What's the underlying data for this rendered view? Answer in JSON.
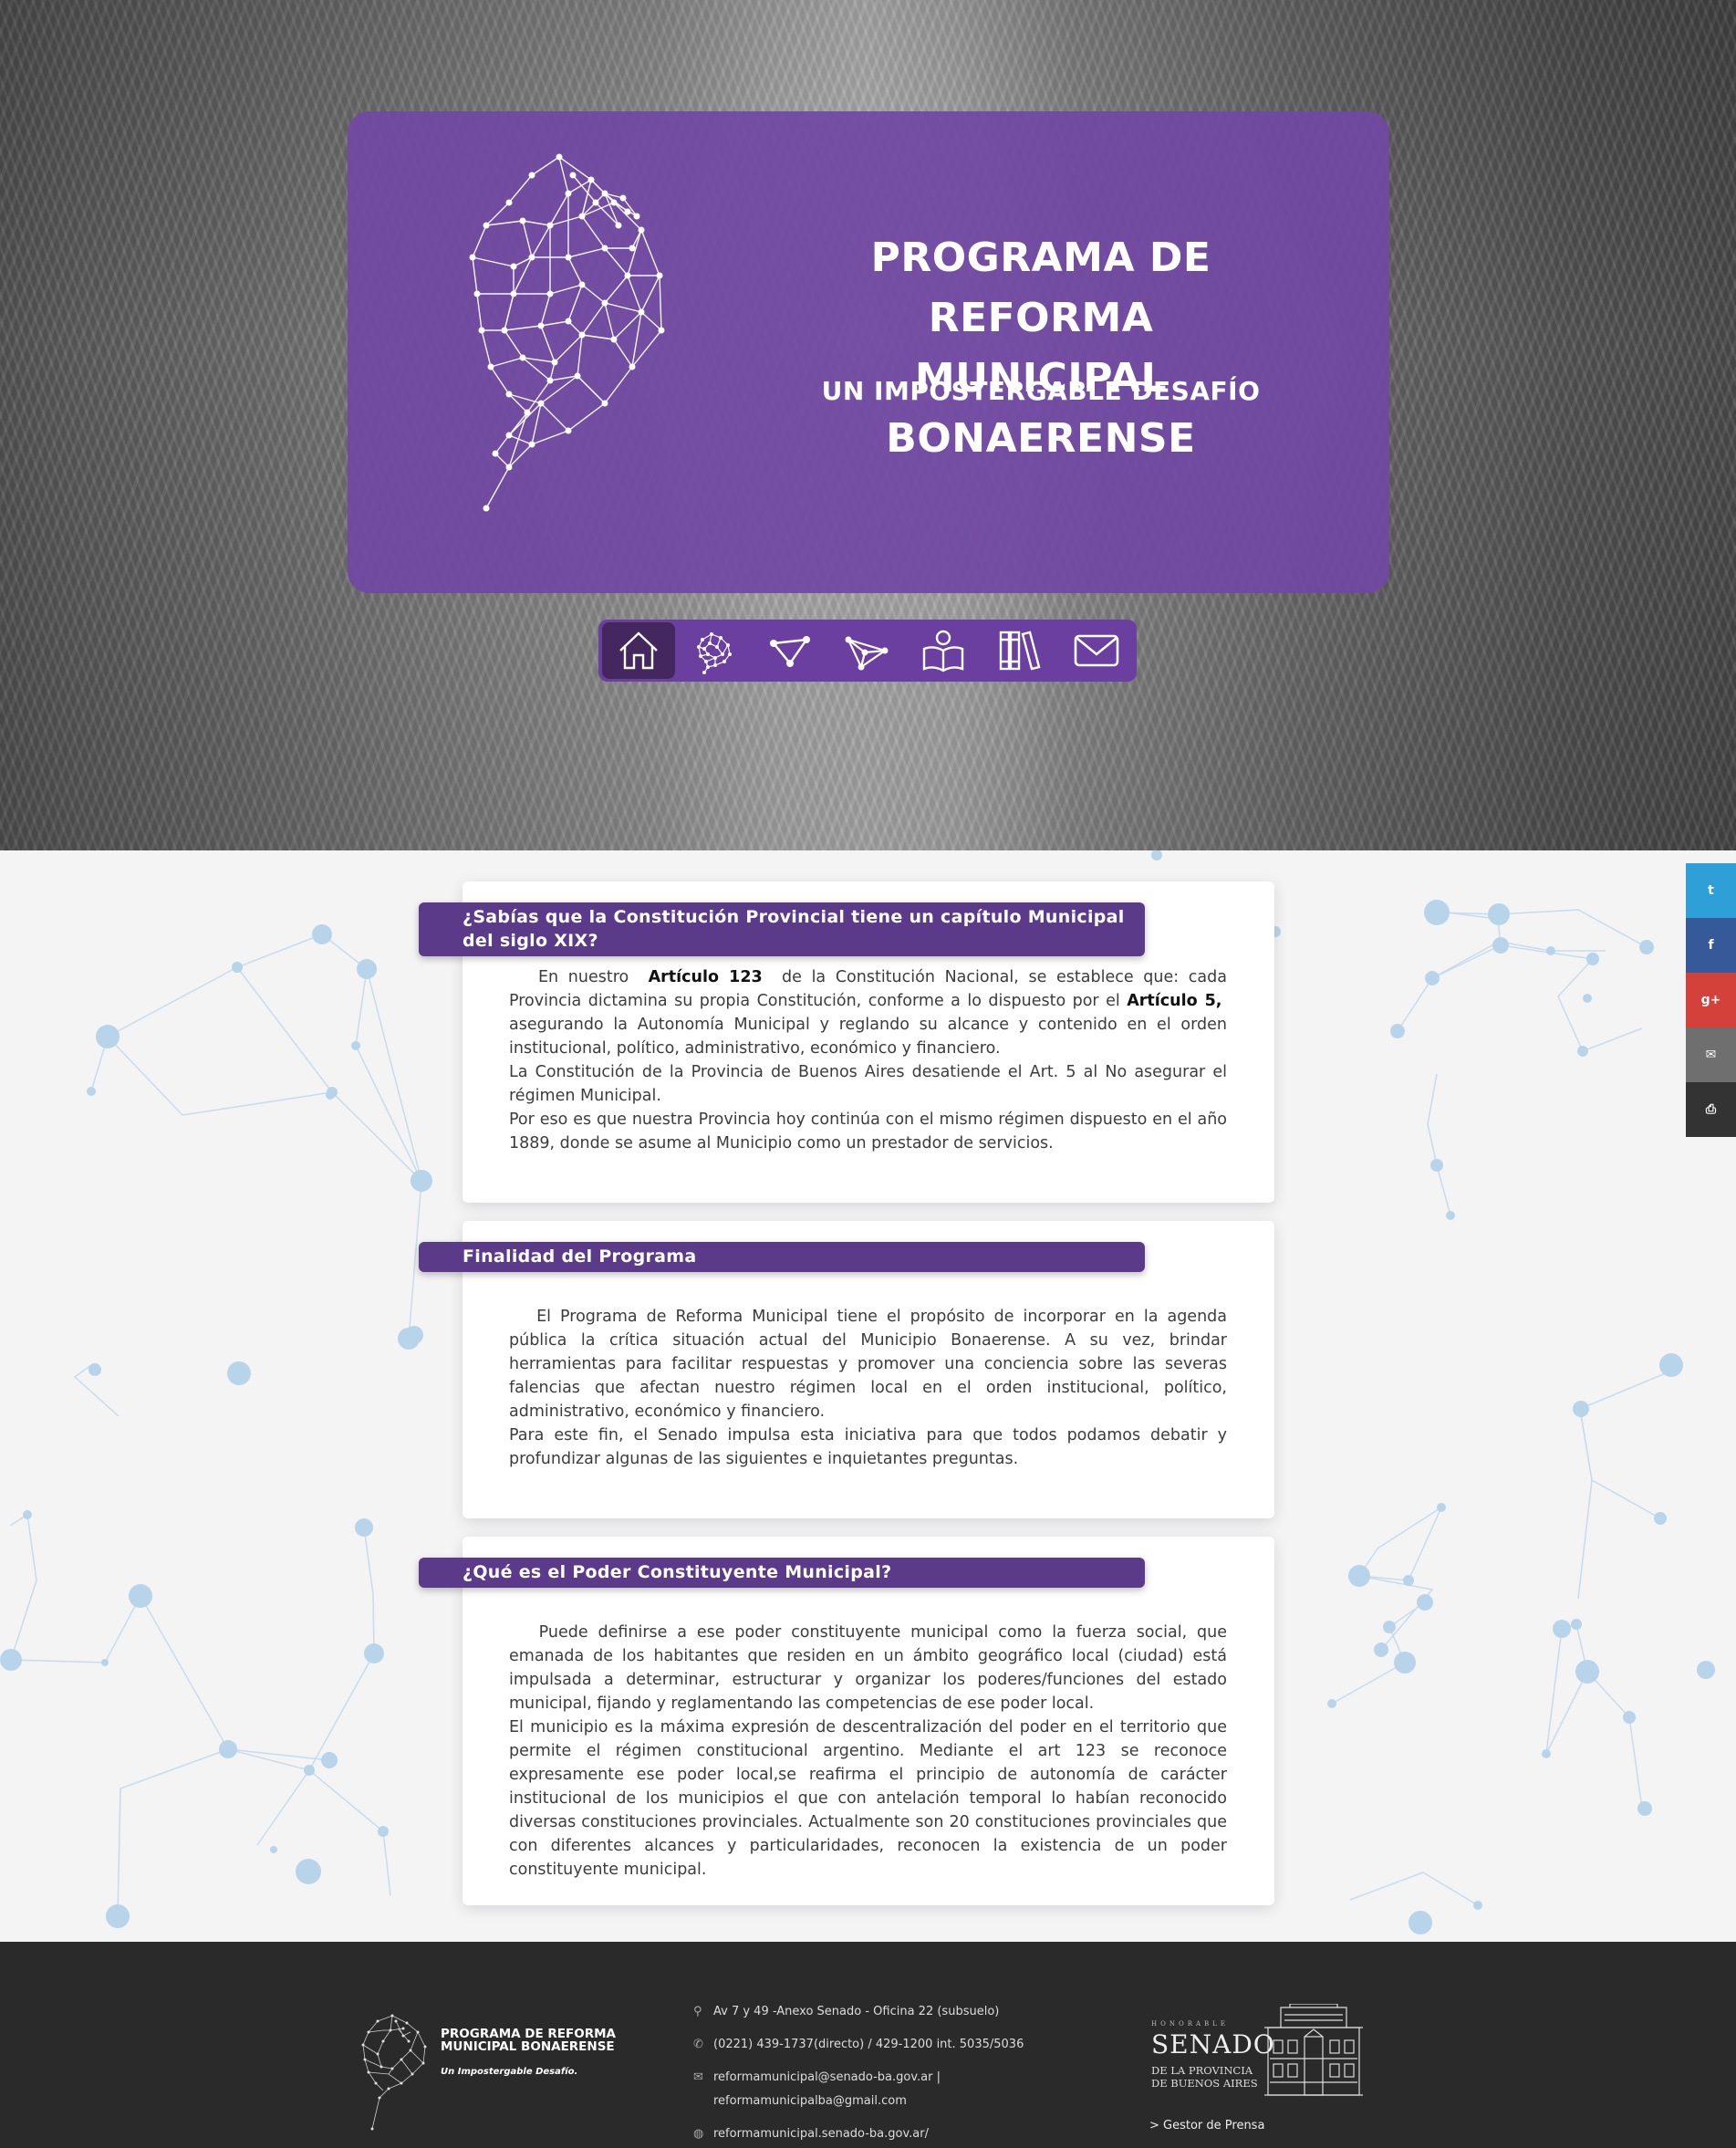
{
  "hero": {
    "title_line1": "PROGRAMA DE REFORMA",
    "title_line2": "MUNICIPAL BONAERENSE",
    "subtitle": "UN IMPOSTERGABLE DESAFÍO"
  },
  "nav": {
    "items": [
      {
        "icon": "home-icon",
        "active": true
      },
      {
        "icon": "province-map-icon",
        "active": false
      },
      {
        "icon": "network-triangle-icon",
        "active": false
      },
      {
        "icon": "network-arrow-icon",
        "active": false
      },
      {
        "icon": "reader-book-icon",
        "active": false
      },
      {
        "icon": "library-books-icon",
        "active": false
      },
      {
        "icon": "envelope-icon",
        "active": false
      }
    ]
  },
  "sections": [
    {
      "heading": "¿Sabías que la Constitución Provincial tiene un capítulo Municipal del siglo XIX?",
      "p1_a": "En nuestro ",
      "p1_b1": "Artículo 123",
      "p1_c": " de la Constitución Nacional, se establece que: cada Provincia dictamina su propia Constitución, conforme a lo dispuesto por el ",
      "p1_b2": "Artículo 5,",
      "p1_d": " asegurando la Autonomía Municipal y reglando su alcance y contenido en el orden institucional, político, administrativo, económico y financiero.",
      "p2": "La Constitución de la Provincia de Buenos Aires desatiende el Art. 5 al No asegurar el régimen Municipal.",
      "p3": "Por eso es que nuestra Provincia hoy continúa con el mismo régimen dispuesto en el año 1889, donde se asume al Municipio como un prestador de servicios."
    },
    {
      "heading": "Finalidad del Programa",
      "p1": "El Programa de Reforma Municipal tiene el propósito de incorporar en la agenda pública la crítica situación actual del Municipio Bonaerense. A su vez, brindar herramientas para facilitar respuestas y promover una conciencia sobre las severas falencias que afectan nuestro régimen local en el orden institucional, político, administrativo, económico y financiero.",
      "p2": "Para este fin, el Senado impulsa esta iniciativa para que todos podamos debatir y profundizar algunas de las siguientes e inquietantes preguntas."
    },
    {
      "heading": "¿Qué es el Poder Constituyente Municipal?",
      "p1": "Puede definirse a ese poder constituyente municipal como la fuerza social, que emanada de los habitantes que residen en un ámbito geográfico local (ciudad) está impulsada a determinar, estructurar y organizar los poderes/funciones del estado municipal, fijando y reglamentando las competencias de ese poder local.",
      "p2": "El municipio es la máxima expresión de descentralización del poder en el territorio que permite el régimen constitucional argentino. Mediante el art 123 se reconoce expresamente ese poder local,se reafirma el principio de autonomía de carácter institucional de los municipios el que con antelación temporal lo habían reconocido diversas constituciones provinciales. Actualmente son 20 constituciones provinciales que con diferentes alcances y particularidades, reconocen la existencia de un poder constituyente municipal."
    }
  ],
  "social": [
    {
      "icon": "twitter-icon",
      "glyph": "t",
      "color": "#2f9fd8"
    },
    {
      "icon": "facebook-icon",
      "glyph": "f",
      "color": "#36599a"
    },
    {
      "icon": "google-plus-icon",
      "glyph": "g+",
      "color": "#d4403a"
    },
    {
      "icon": "email-icon",
      "glyph": "✉",
      "color": "#6f6f6f"
    },
    {
      "icon": "print-icon",
      "glyph": "⎙",
      "color": "#333333"
    }
  ],
  "footer": {
    "logo_title": "PROGRAMA DE REFORMA MUNICIPAL BONAERENSE",
    "logo_tagline": "Un Impostergable Desafío.",
    "address": "Av 7 y 49 -Anexo Senado - Oficina 22 (subsuelo)",
    "phone": "(0221) 439-1737(directo) / 429-1200 int. 5035/5036",
    "email_line1": "reformamunicipal@senado-ba.gov.ar |",
    "email_line2": "reformamunicipalba@gmail.com",
    "website": "reformamunicipal.senado-ba.gov.ar/",
    "senado_honorable": "HONORABLE",
    "senado_name": "SENADO",
    "senado_sub": "DE LA PROVINCIA DE BUENOS AIRES",
    "gestor_link": "> Gestor de Prensa"
  },
  "colors": {
    "purple_panel": "#7048a3",
    "purple_heading": "#5c3a8a",
    "footer_bg": "#2a2a2a"
  }
}
